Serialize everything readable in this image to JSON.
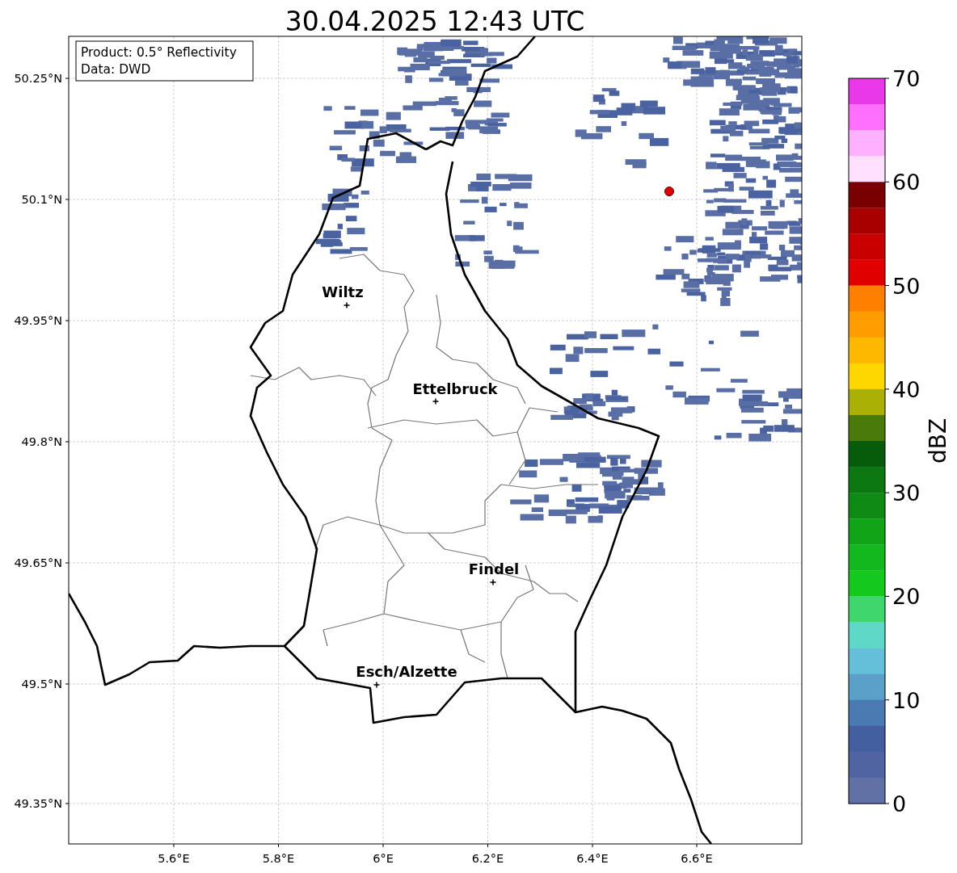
{
  "title": "30.04.2025 12:43 UTC",
  "info_box": [
    "Product: 0.5° Reflectivity",
    "Data: DWD"
  ],
  "lat_ticks": [
    "50.25°N",
    "50.1°N",
    "49.95°N",
    "49.8°N",
    "49.65°N",
    "49.5°N",
    "49.35°N"
  ],
  "lon_ticks": [
    "5.6°E",
    "5.8°E",
    "6°E",
    "6.2°E",
    "6.4°E",
    "6.6°E"
  ],
  "cities": [
    {
      "name": "Wiltz"
    },
    {
      "name": "Ettelbruck"
    },
    {
      "name": "Findel"
    },
    {
      "name": "Esch/Alzette"
    }
  ],
  "colorbar": {
    "label": "dBZ",
    "ticks": [
      "70",
      "60",
      "50",
      "40",
      "30",
      "20",
      "10",
      "0"
    ],
    "segments": [
      {
        "color": "#e838e8"
      },
      {
        "color": "#ff70ff"
      },
      {
        "color": "#ffb0ff"
      },
      {
        "color": "#ffe0ff"
      },
      {
        "color": "#780000"
      },
      {
        "color": "#a80000"
      },
      {
        "color": "#c80000"
      },
      {
        "color": "#e00000"
      },
      {
        "color": "#ff8000"
      },
      {
        "color": "#ff9c00"
      },
      {
        "color": "#ffb800"
      },
      {
        "color": "#ffd700"
      },
      {
        "color": "#aab006"
      },
      {
        "color": "#4a7a0a"
      },
      {
        "color": "#075c0c"
      },
      {
        "color": "#0b7812"
      },
      {
        "color": "#0f8a14"
      },
      {
        "color": "#12a418"
      },
      {
        "color": "#12b81e"
      },
      {
        "color": "#14c81e"
      },
      {
        "color": "#3fd66e"
      },
      {
        "color": "#60d8c8"
      },
      {
        "color": "#64c0d8"
      },
      {
        "color": "#5aa0c8"
      },
      {
        "color": "#4a7ab1"
      },
      {
        "color": "#445fa0"
      },
      {
        "color": "#4f64a0"
      },
      {
        "color": "#6171a6"
      }
    ]
  }
}
